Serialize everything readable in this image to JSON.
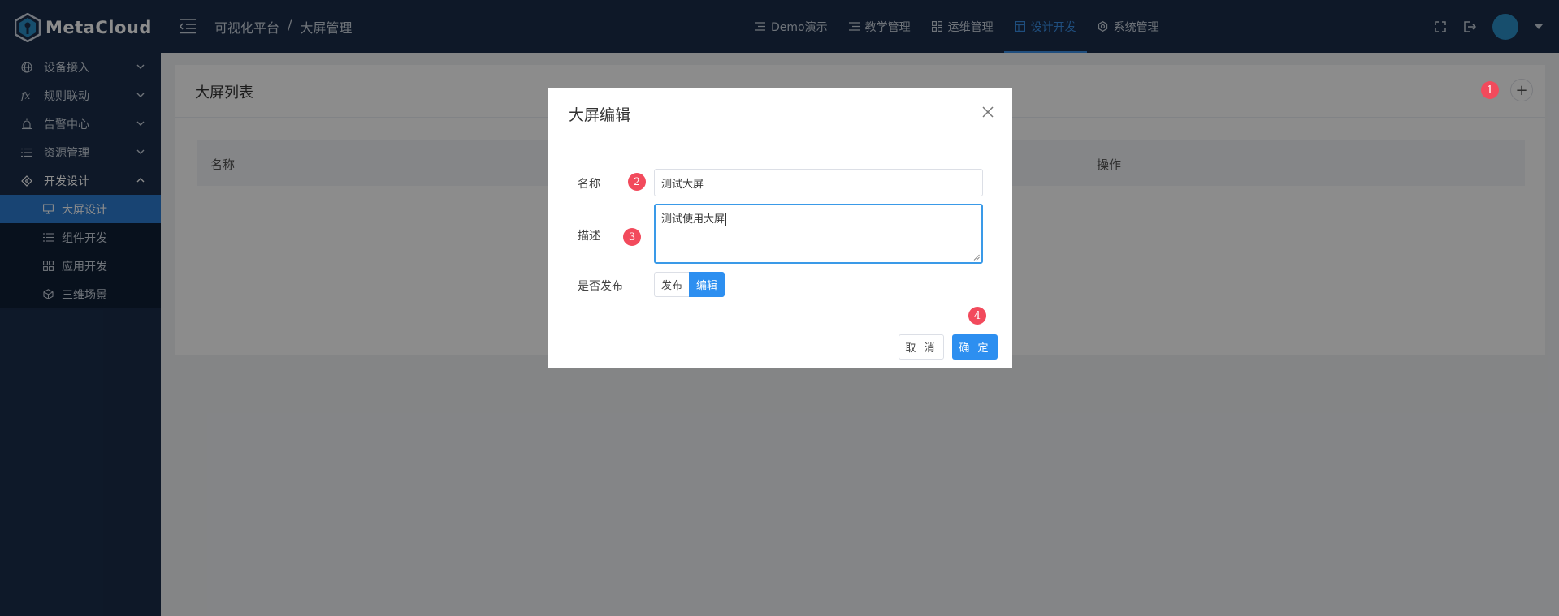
{
  "header": {
    "logo_text": "MetaCloud",
    "breadcrumb": [
      "可视化平台",
      "/",
      "大屏管理"
    ],
    "nav": [
      {
        "label": "Demo演示",
        "icon": "list-icon"
      },
      {
        "label": "教学管理",
        "icon": "list-icon"
      },
      {
        "label": "运维管理",
        "icon": "grid-icon"
      },
      {
        "label": "设计开发",
        "icon": "layout-icon",
        "active": true
      },
      {
        "label": "系统管理",
        "icon": "gear-icon"
      }
    ]
  },
  "sidebar": {
    "items": [
      {
        "label": "设备接入",
        "icon": "globe-icon"
      },
      {
        "label": "规则联动",
        "icon": "fx-icon",
        "icon_text": "fx"
      },
      {
        "label": "告警中心",
        "icon": "alarm-icon"
      },
      {
        "label": "资源管理",
        "icon": "list-icon"
      },
      {
        "label": "开发设计",
        "icon": "diamond-icon",
        "open": true
      }
    ],
    "subitems": [
      {
        "label": "大屏设计",
        "icon": "monitor-icon",
        "active": true
      },
      {
        "label": "组件开发",
        "icon": "list-icon"
      },
      {
        "label": "应用开发",
        "icon": "grid-icon"
      },
      {
        "label": "三维场景",
        "icon": "cube-icon"
      }
    ]
  },
  "main": {
    "title": "大屏列表",
    "add_label": "+",
    "table_headers": {
      "name": "名称",
      "op": "操作"
    }
  },
  "dialog": {
    "title": "大屏编辑",
    "name_label": "名称",
    "name_value": "测试大屏",
    "desc_label": "描述",
    "desc_value": "测试使用大屏",
    "publish_label": "是否发布",
    "publish_options": [
      "发布",
      "编辑"
    ],
    "publish_selected": "编辑",
    "cancel_label": "取 消",
    "ok_label": "确 定"
  },
  "badges": [
    "1",
    "2",
    "3",
    "4"
  ],
  "colors": {
    "header_bg": "#1a2d4a",
    "accent": "#2d8ff0",
    "badge": "#f24a5c"
  }
}
